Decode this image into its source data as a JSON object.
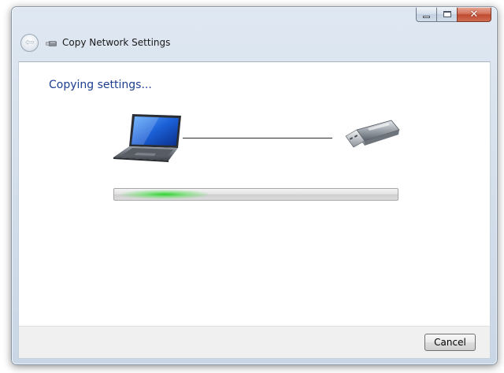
{
  "window": {
    "title": "Copy Network Settings",
    "caption_buttons": {
      "minimize_icon": "minimize-icon",
      "maximize_icon": "maximize-icon",
      "close_icon": "close-icon",
      "close_glyph": "✕"
    }
  },
  "header": {
    "back_icon": "back-arrow-icon",
    "back_glyph": "⇦",
    "title_icon": "usb-drive-icon"
  },
  "main": {
    "heading": "Copying settings...",
    "source_icon": "laptop-icon",
    "target_icon": "usb-drive-icon",
    "progress": {
      "state": "indeterminate",
      "indicator_color": "#28d228"
    }
  },
  "footer": {
    "cancel_label": "Cancel"
  },
  "colors": {
    "heading": "#1e3e8f",
    "close_button": "#c04a30",
    "window_frame": "#c9d6e5"
  }
}
